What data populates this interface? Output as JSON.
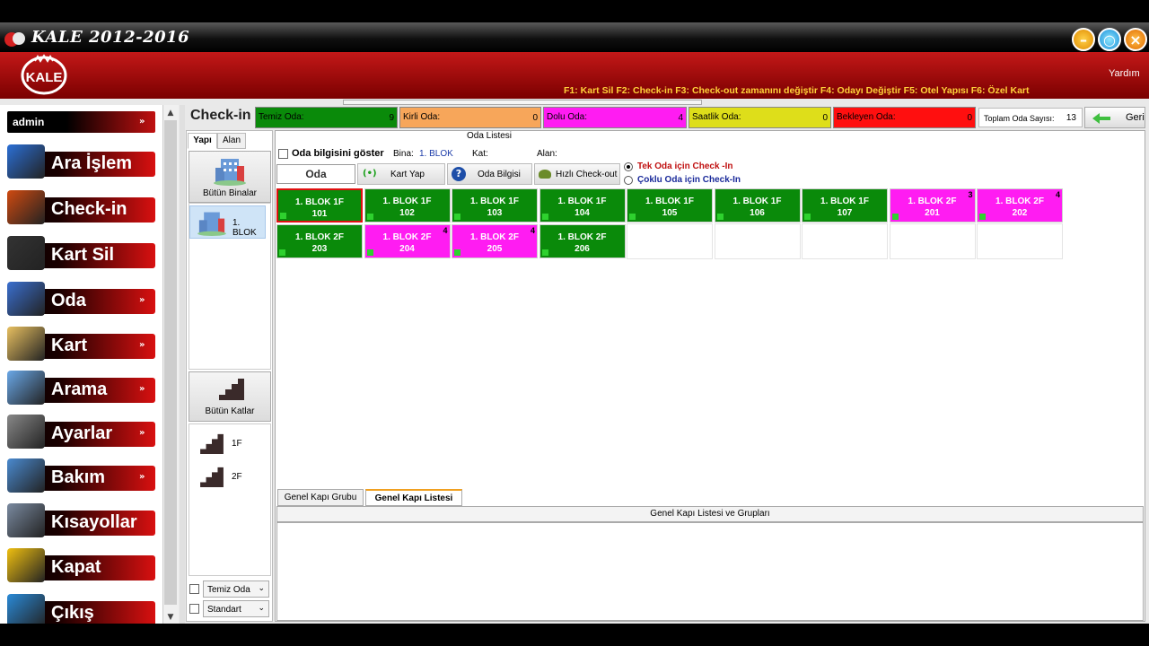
{
  "app": {
    "title": "KALE 2012-2016",
    "logo_text": "KALE",
    "help": "Yardım"
  },
  "shortcuts": "F1: Kart Sil  F2: Check-in  F3: Check-out zamanını değiştir  F4: Odayı Değiştir  F5: Otel Yapısı  F6: Özel Kart",
  "sidebar": {
    "user": "admin",
    "items": [
      {
        "label": "Ara İşlem",
        "icon": "monitor-icon",
        "chevron": false
      },
      {
        "label": "Check-in",
        "icon": "suitcase-icon",
        "chevron": false
      },
      {
        "label": "Kart Sil",
        "icon": "trash-icon",
        "chevron": false
      },
      {
        "label": "Oda",
        "icon": "room-icon",
        "chevron": true
      },
      {
        "label": "Kart",
        "icon": "folder-icon",
        "chevron": true
      },
      {
        "label": "Arama",
        "icon": "magnifier-icon",
        "chevron": true
      },
      {
        "label": "Ayarlar",
        "icon": "gear-icon",
        "chevron": true
      },
      {
        "label": "Bakım",
        "icon": "maintenance-icon",
        "chevron": true
      },
      {
        "label": "Kısayollar",
        "icon": "shortcut-icon",
        "chevron": false
      },
      {
        "label": "Kapat",
        "icon": "power-icon",
        "chevron": false
      },
      {
        "label": "Çıkış",
        "icon": "exit-door-icon",
        "chevron": false
      }
    ]
  },
  "page_title": "Check-in",
  "stats": [
    {
      "label": "Temiz Oda:",
      "value": "9",
      "color": "#0a8a0a"
    },
    {
      "label": "Kirli Oda:",
      "value": "0",
      "color": "#f7a65a"
    },
    {
      "label": "Dolu Oda:",
      "value": "4",
      "color": "#ff1cf2"
    },
    {
      "label": "Saatlik Oda:",
      "value": "0",
      "color": "#dede1a"
    },
    {
      "label": "Bekleyen Oda:",
      "value": "0",
      "color": "#ff0f0f"
    }
  ],
  "total": {
    "label": "Toplam Oda Sayısı:",
    "value": "13"
  },
  "back_label": "Geri",
  "left_panel": {
    "tabs": [
      "Yapı",
      "Alan"
    ],
    "all_buildings": "Bütün Binalar",
    "building": "1. BLOK",
    "all_floors": "Bütün Katlar",
    "floors": [
      "1F",
      "2F"
    ],
    "combo1": "Temiz Oda",
    "combo2": "Standart"
  },
  "room_panel": {
    "title": "Oda Listesi",
    "show_info": "Oda bilgisini göster",
    "bina_label": "Bina:",
    "bina_value": "1. BLOK",
    "kat_label": "Kat:",
    "alan_label": "Alan:",
    "oda_field": "Oda",
    "kart_yap": "Kart Yap",
    "oda_bilgisi": "Oda Bilgisi",
    "hizli_checkout": "Hızlı  Check-out",
    "radio_single": "Tek Oda için Check -In",
    "radio_multi": "Çoklu Oda için  Check-In"
  },
  "rooms": [
    {
      "line1": "1. BLOK  1F",
      "line2": "101",
      "status": "clean",
      "selected": true,
      "badge": ""
    },
    {
      "line1": "1. BLOK  1F",
      "line2": "102",
      "status": "clean",
      "selected": false,
      "badge": ""
    },
    {
      "line1": "1. BLOK  1F",
      "line2": "103",
      "status": "clean",
      "selected": false,
      "badge": ""
    },
    {
      "line1": "1. BLOK  1F",
      "line2": "104",
      "status": "clean",
      "selected": false,
      "badge": ""
    },
    {
      "line1": "1. BLOK  1F",
      "line2": "105",
      "status": "clean",
      "selected": false,
      "badge": ""
    },
    {
      "line1": "1. BLOK  1F",
      "line2": "106",
      "status": "clean",
      "selected": false,
      "badge": ""
    },
    {
      "line1": "1. BLOK  1F",
      "line2": "107",
      "status": "clean",
      "selected": false,
      "badge": ""
    },
    {
      "line1": "1. BLOK  2F",
      "line2": "201",
      "status": "occupied",
      "selected": false,
      "badge": "3"
    },
    {
      "line1": "1. BLOK  2F",
      "line2": "202",
      "status": "occupied",
      "selected": false,
      "badge": "4"
    },
    {
      "line1": "1. BLOK  2F",
      "line2": "203",
      "status": "clean",
      "selected": false,
      "badge": ""
    },
    {
      "line1": "1. BLOK  2F",
      "line2": "204",
      "status": "occupied",
      "selected": false,
      "badge": "4"
    },
    {
      "line1": "1. BLOK  2F",
      "line2": "205",
      "status": "occupied",
      "selected": false,
      "badge": "4"
    },
    {
      "line1": "1. BLOK  2F",
      "line2": "206",
      "status": "clean",
      "selected": false,
      "badge": ""
    }
  ],
  "status_colors": {
    "clean": "#0a8a0a",
    "occupied": "#ff1cf2",
    "selected_border": "#e01010"
  },
  "bottom_tabs": [
    "Genel Kapı Grubu",
    "Genel Kapı Listesi"
  ],
  "door_header": "Genel Kapı Listesi ve Grupları"
}
